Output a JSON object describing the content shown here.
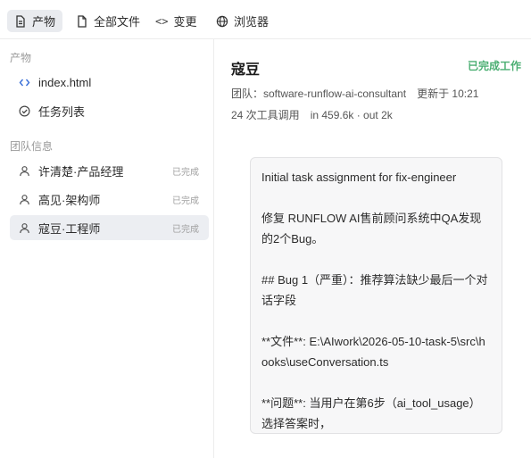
{
  "tabs": [
    {
      "label": "产物",
      "icon": "document-icon",
      "active": true
    },
    {
      "label": "全部文件",
      "icon": "file-icon"
    },
    {
      "label": "变更",
      "icon": "code-icon"
    },
    {
      "label": "浏览器",
      "icon": "globe-icon"
    }
  ],
  "sidebar": {
    "artifacts_title": "产物",
    "artifacts": [
      {
        "label": "index.html",
        "icon": "code-icon"
      },
      {
        "label": "任务列表",
        "icon": "check-circle-icon"
      }
    ],
    "team_title": "团队信息",
    "team": [
      {
        "label": "许清楚·产品经理",
        "status": "已完成",
        "icon": "user-icon"
      },
      {
        "label": "高见·架构师",
        "status": "已完成",
        "icon": "user-icon"
      },
      {
        "label": "寇豆·工程师",
        "status": "已完成",
        "icon": "user-icon",
        "active": true
      }
    ]
  },
  "main": {
    "name": "寇豆",
    "status": "已完成工作",
    "team_label": "团队：software-runflow-ai-consultant",
    "updated": "更新于 10:21",
    "tool_calls": "24 次工具调用",
    "tokens": "in 459.6k · out 2k",
    "message": [
      "Initial task assignment for fix-engineer",
      "修复 RUNFLOW AI售前顾问系统中QA发现的2个Bug。",
      "## Bug 1（严重）：推荐算法缺少最后一个对话字段",
      "**文件**: E:\\AIwork\\2026-05-10-task-5\\src\\hooks\\useConversation.ts",
      "**问题**: 当用户在第6步（ai_tool_usage）选择答案时，"
    ]
  },
  "colors": {
    "accent_green": "#4caf73",
    "active_bg": "#e9ebef"
  }
}
